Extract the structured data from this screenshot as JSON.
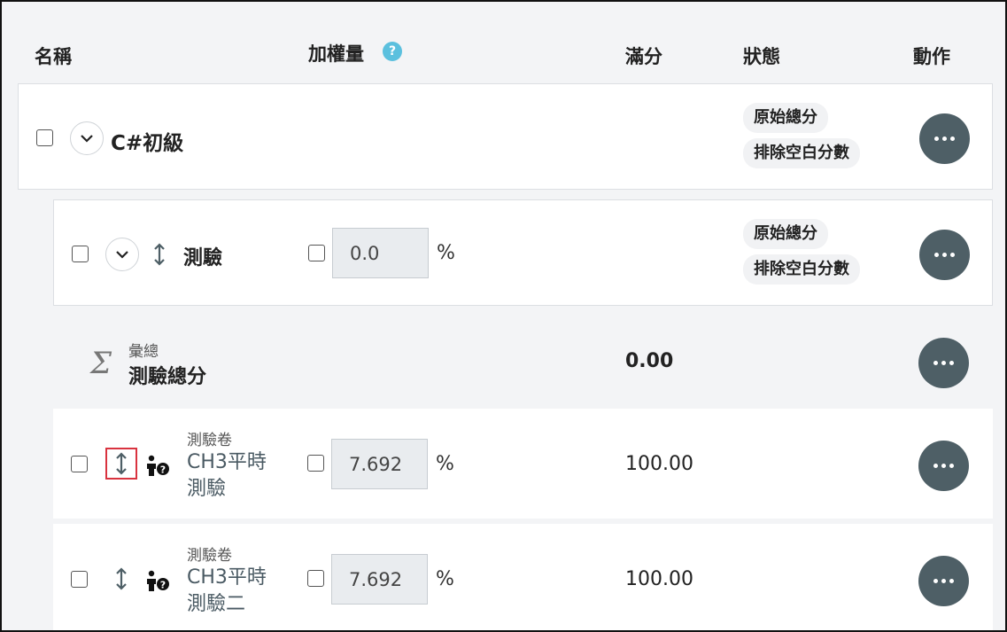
{
  "header": {
    "name": "名稱",
    "weight": "加權量",
    "help": "?",
    "max": "滿分",
    "status": "狀態",
    "actions": "動作"
  },
  "category": {
    "name": "C#初級",
    "badges": [
      "原始總分",
      "排除空白分數"
    ]
  },
  "subcategory": {
    "name": "測驗",
    "weight": "0.0",
    "percent": "%",
    "badges": [
      "原始總分",
      "排除空白分數"
    ]
  },
  "total": {
    "symbol": "Σ",
    "label": "彙總",
    "name": "測驗總分",
    "value": "0.00"
  },
  "items": [
    {
      "type": "測驗卷",
      "name_line1": "CH3平時",
      "name_line2": "測驗",
      "weight": "7.692",
      "percent": "%",
      "max": "100.00"
    },
    {
      "type": "測驗卷",
      "name_line1": "CH3平時",
      "name_line2": "測驗二",
      "weight": "7.692",
      "percent": "%",
      "max": "100.00"
    }
  ],
  "colors": {
    "dots_button": "#4e5f66",
    "help_icon": "#5bc0de",
    "highlight": "#d9333f"
  }
}
